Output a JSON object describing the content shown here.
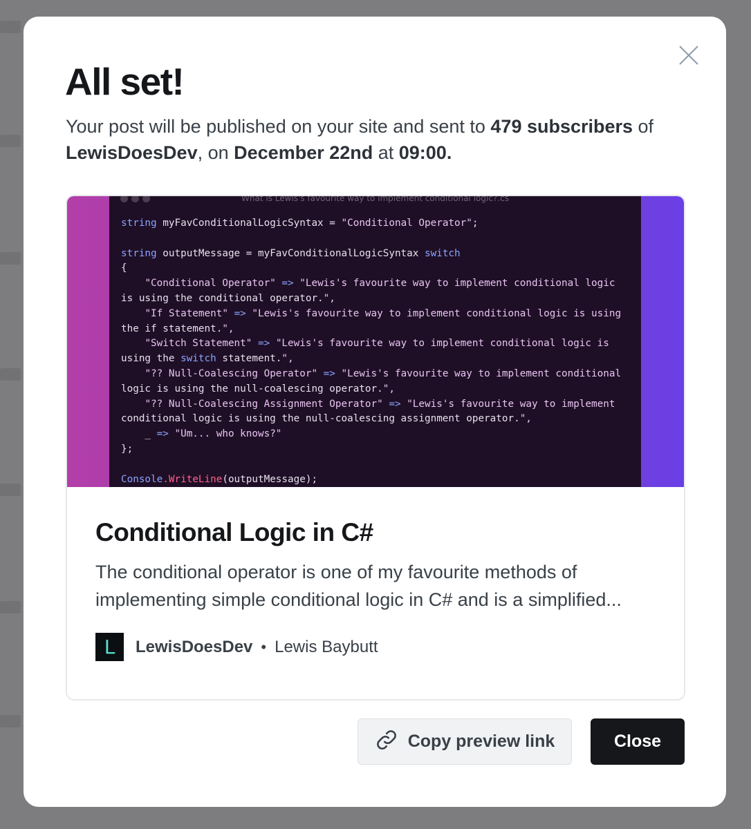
{
  "modal": {
    "title": "All set!",
    "description": {
      "p1": "Your post will be published on your site and sent to ",
      "subscribers": "479 subscribers",
      "p2": " of ",
      "site": "LewisDoesDev",
      "p3": ", on ",
      "date": "December 22nd",
      "p4": " at ",
      "time": "09:00."
    },
    "close_icon": "close-icon"
  },
  "card": {
    "feature_image": {
      "window_title": "What is Lewis's favourite way to implement conditional logic?.cs",
      "code_lines": [
        "string myFavConditionalLogicSyntax = \"Conditional Operator\";",
        "",
        "string outputMessage = myFavConditionalLogicSyntax switch",
        "{",
        "    \"Conditional Operator\" => \"Lewis's favourite way to implement conditional logic",
        "is using the conditional operator.\",",
        "    \"If Statement\" => \"Lewis's favourite way to implement conditional logic is using",
        "the if statement.\",",
        "    \"Switch Statement\" => \"Lewis's favourite way to implement conditional logic is",
        "using the switch statement.\",",
        "    \"?? Null-Coalescing Operator\" => \"Lewis's favourite way to implement conditional",
        "logic is using the null-coalescing operator.\",",
        "    \"?? Null-Coalescing Assignment Operator\" => \"Lewis's favourite way to implement",
        "conditional logic is using the null-coalescing assignment operator.\",",
        "    _ => \"Um... who knows?\"",
        "};",
        "",
        "Console.WriteLine(outputMessage);"
      ]
    },
    "title": "Conditional Logic in C#",
    "excerpt": "The conditional operator is one of my favourite methods of implementing simple conditional logic in C# and is a simplified...",
    "logo_letter": "L",
    "site_name": "LewisDoesDev",
    "separator": "•",
    "author": "Lewis Baybutt"
  },
  "actions": {
    "copy_label": "Copy preview link",
    "copy_icon": "link-icon",
    "close_label": "Close"
  },
  "colors": {
    "primary_button": "#15171a",
    "secondary_button": "#f1f2f4",
    "gradient_left": "#b33ea8",
    "gradient_right": "#6a3fe6"
  }
}
